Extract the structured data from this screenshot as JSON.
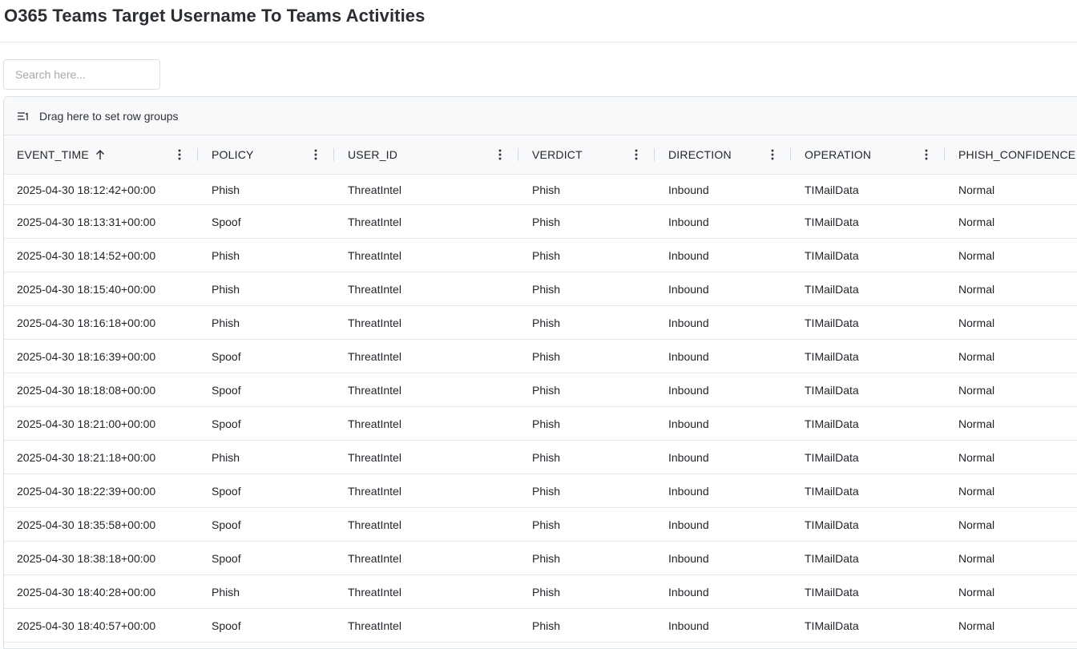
{
  "page": {
    "title": "O365 Teams Target Username To Teams Activities"
  },
  "search": {
    "placeholder": "Search here..."
  },
  "grid": {
    "group_panel_label": "Drag here to set row groups",
    "columns": [
      {
        "key": "event_time",
        "label": "EVENT_TIME",
        "sorted": "asc"
      },
      {
        "key": "policy",
        "label": "POLICY"
      },
      {
        "key": "user_id",
        "label": "USER_ID"
      },
      {
        "key": "verdict",
        "label": "VERDICT"
      },
      {
        "key": "direction",
        "label": "DIRECTION"
      },
      {
        "key": "operation",
        "label": "OPERATION"
      },
      {
        "key": "phish_confidence",
        "label": "PHISH_CONFIDENCE"
      }
    ],
    "rows": [
      [
        "2025-04-30 18:12:42+00:00",
        "Phish",
        "ThreatIntel",
        "Phish",
        "Inbound",
        "TIMailData",
        "Normal"
      ],
      [
        "2025-04-30 18:13:31+00:00",
        "Spoof",
        "ThreatIntel",
        "Phish",
        "Inbound",
        "TIMailData",
        "Normal"
      ],
      [
        "2025-04-30 18:14:52+00:00",
        "Phish",
        "ThreatIntel",
        "Phish",
        "Inbound",
        "TIMailData",
        "Normal"
      ],
      [
        "2025-04-30 18:15:40+00:00",
        "Phish",
        "ThreatIntel",
        "Phish",
        "Inbound",
        "TIMailData",
        "Normal"
      ],
      [
        "2025-04-30 18:16:18+00:00",
        "Phish",
        "ThreatIntel",
        "Phish",
        "Inbound",
        "TIMailData",
        "Normal"
      ],
      [
        "2025-04-30 18:16:39+00:00",
        "Spoof",
        "ThreatIntel",
        "Phish",
        "Inbound",
        "TIMailData",
        "Normal"
      ],
      [
        "2025-04-30 18:18:08+00:00",
        "Spoof",
        "ThreatIntel",
        "Phish",
        "Inbound",
        "TIMailData",
        "Normal"
      ],
      [
        "2025-04-30 18:21:00+00:00",
        "Spoof",
        "ThreatIntel",
        "Phish",
        "Inbound",
        "TIMailData",
        "Normal"
      ],
      [
        "2025-04-30 18:21:18+00:00",
        "Phish",
        "ThreatIntel",
        "Phish",
        "Inbound",
        "TIMailData",
        "Normal"
      ],
      [
        "2025-04-30 18:22:39+00:00",
        "Spoof",
        "ThreatIntel",
        "Phish",
        "Inbound",
        "TIMailData",
        "Normal"
      ],
      [
        "2025-04-30 18:35:58+00:00",
        "Spoof",
        "ThreatIntel",
        "Phish",
        "Inbound",
        "TIMailData",
        "Normal"
      ],
      [
        "2025-04-30 18:38:18+00:00",
        "Spoof",
        "ThreatIntel",
        "Phish",
        "Inbound",
        "TIMailData",
        "Normal"
      ],
      [
        "2025-04-30 18:40:28+00:00",
        "Phish",
        "ThreatIntel",
        "Phish",
        "Inbound",
        "TIMailData",
        "Normal"
      ],
      [
        "2025-04-30 18:40:57+00:00",
        "Spoof",
        "ThreatIntel",
        "Phish",
        "Inbound",
        "TIMailData",
        "Normal"
      ]
    ]
  }
}
